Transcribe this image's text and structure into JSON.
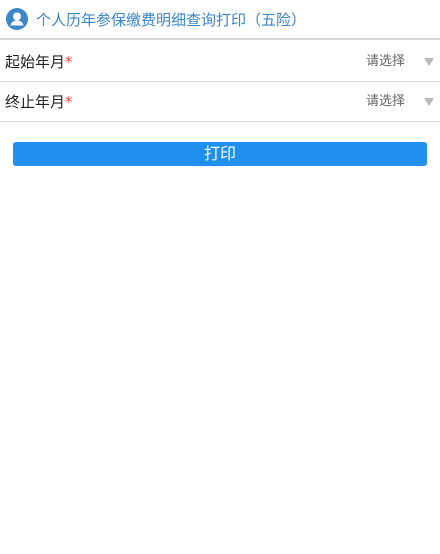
{
  "header": {
    "icon": "user-icon",
    "title": "个人历年参保缴费明细查询打印（五险）",
    "accent_color": "#3a86c8"
  },
  "form": {
    "start_month": {
      "label": "起始年月",
      "required_mark": "*",
      "value": "请选择",
      "icon": "caret-down-icon"
    },
    "end_month": {
      "label": "终止年月",
      "required_mark": "*",
      "value": "请选择",
      "icon": "caret-down-icon"
    }
  },
  "actions": {
    "print_label": "打印",
    "button_color": "#1f8ff0"
  }
}
